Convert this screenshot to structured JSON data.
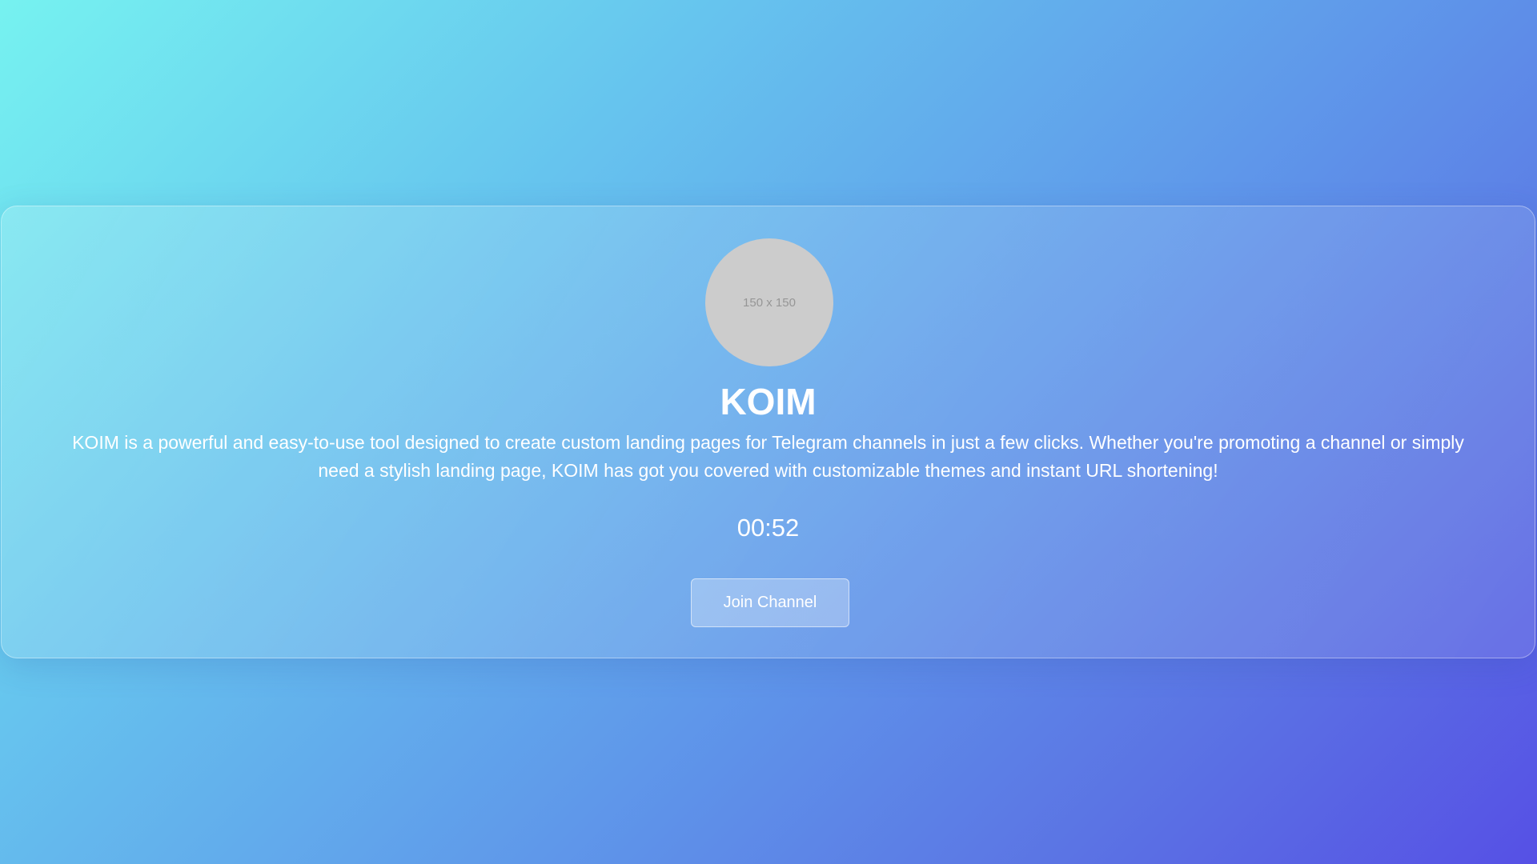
{
  "channel": {
    "avatar_placeholder": "150 x 150",
    "name": "KOIM",
    "description": "KOIM is a powerful and easy-to-use tool designed to create custom landing pages for Telegram channels in just a few clicks. Whether you're promoting a channel or simply need a stylish landing page, KOIM has got you covered with customizable themes and instant URL shortening!",
    "countdown": "00:52",
    "join_label": "Join Channel"
  },
  "colors": {
    "gradient_start": "#76f2f0",
    "gradient_end": "#5650e5",
    "text": "#ffffff",
    "avatar_bg": "#cccccc"
  }
}
